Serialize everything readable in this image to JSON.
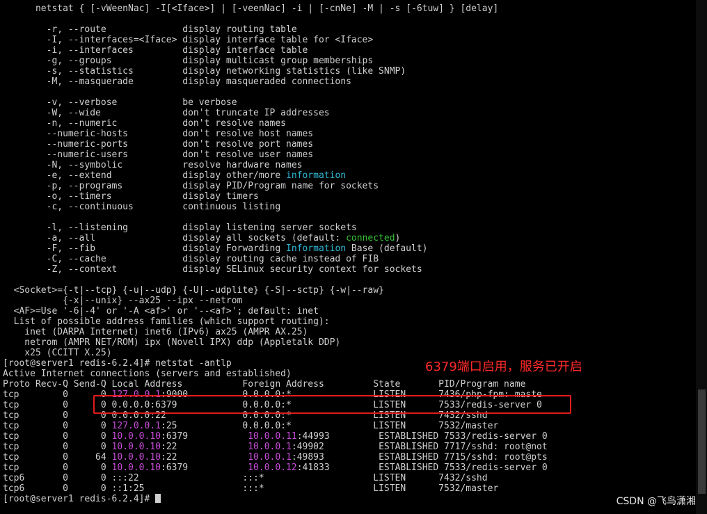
{
  "terminal": {
    "lines": [
      [
        [
          "      netstat { [-vWeenNac] -I[<Iface>] | [-veenNac] -i | [-cnNe] -M | -s [-6tuw] } [delay]",
          ""
        ]
      ],
      [
        [
          "",
          ""
        ]
      ],
      [
        [
          "        -r, --route              display routing table",
          ""
        ]
      ],
      [
        [
          "        -I, --interfaces=<Iface> display interface table for <Iface>",
          ""
        ]
      ],
      [
        [
          "        -i, --interfaces         display interface table",
          ""
        ]
      ],
      [
        [
          "        -g, --groups             display multicast group memberships",
          ""
        ]
      ],
      [
        [
          "        -s, --statistics         display networking statistics (like SNMP)",
          ""
        ]
      ],
      [
        [
          "        -M, --masquerade         display masqueraded connections",
          ""
        ]
      ],
      [
        [
          "",
          ""
        ]
      ],
      [
        [
          "        -v, --verbose            be verbose",
          ""
        ]
      ],
      [
        [
          "        -W, --wide               don't truncate IP addresses",
          ""
        ]
      ],
      [
        [
          "        -n, --numeric            don't resolve names",
          ""
        ]
      ],
      [
        [
          "        --numeric-hosts          don't resolve host names",
          ""
        ]
      ],
      [
        [
          "        --numeric-ports          don't resolve port names",
          ""
        ]
      ],
      [
        [
          "        --numeric-users          don't resolve user names",
          ""
        ]
      ],
      [
        [
          "        -N, --symbolic           resolve hardware names",
          ""
        ]
      ],
      [
        [
          "        -e, --extend             display other/more ",
          ""
        ],
        [
          "information",
          "cyan"
        ]
      ],
      [
        [
          "        -p, --programs           display PID/Program name for sockets",
          ""
        ]
      ],
      [
        [
          "        -o, --timers             display timers",
          ""
        ]
      ],
      [
        [
          "        -c, --continuous         continuous listing",
          ""
        ]
      ],
      [
        [
          "",
          ""
        ]
      ],
      [
        [
          "        -l, --listening          display listening server sockets",
          ""
        ]
      ],
      [
        [
          "        -a, --all                display all sockets (default: ",
          ""
        ],
        [
          "connected",
          "green"
        ],
        [
          ")",
          ""
        ]
      ],
      [
        [
          "        -F, --fib                display Forwarding ",
          ""
        ],
        [
          "Information",
          "cyan"
        ],
        [
          " Base (default)",
          ""
        ]
      ],
      [
        [
          "        -C, --cache              display routing cache instead of FIB",
          ""
        ]
      ],
      [
        [
          "        -Z, --context            display SELinux security context for sockets",
          ""
        ]
      ],
      [
        [
          "",
          ""
        ]
      ],
      [
        [
          "  <Socket>={-t|--tcp} {-u|--udp} {-U|--udplite} {-S|--sctp} {-w|--raw}",
          ""
        ]
      ],
      [
        [
          "           {-x|--unix} --ax25 --ipx --netrom",
          ""
        ]
      ],
      [
        [
          "  <AF>=Use '-6|-4' or '-A <af>' or '--<af>'; default: inet",
          ""
        ]
      ],
      [
        [
          "  List of possible address families (which support routing):",
          ""
        ]
      ],
      [
        [
          "    inet (DARPA Internet) inet6 (IPv6) ax25 (AMPR AX.25)",
          ""
        ]
      ],
      [
        [
          "    netrom (AMPR NET/ROM) ipx (Novell IPX) ddp (Appletalk DDP)",
          ""
        ]
      ],
      [
        [
          "    x25 (CCITT X.25)",
          ""
        ]
      ],
      [
        [
          "[root@server1 redis-6.2.4]# netstat -antlp",
          ""
        ]
      ],
      [
        [
          "Active Internet connections (servers and established)",
          ""
        ]
      ],
      [
        [
          "Proto Recv-Q Send-Q Local Address           Foreign Address         State       PID/Program name",
          ""
        ]
      ],
      [
        [
          "tcp        0      0 ",
          ""
        ],
        [
          "127.0.0.1",
          "magenta"
        ],
        [
          ":9000          0.0.0.0:*               LISTEN      7436/php-fpm: maste",
          ""
        ]
      ],
      [
        [
          "tcp        0      0 0.0.0.0:6379            0.0.0.0:*               LISTEN      7533/redis-server 0",
          ""
        ]
      ],
      [
        [
          "tcp        0      0 0.0.0.0:22              0.0.0.0:*               LISTEN      7432/sshd",
          ""
        ]
      ],
      [
        [
          "tcp        0      0 ",
          ""
        ],
        [
          "127.0.0.1",
          "magenta"
        ],
        [
          ":25            0.0.0.0:*               LISTEN      7532/master",
          ""
        ]
      ],
      [
        [
          "tcp        0      0 ",
          ""
        ],
        [
          "10.0.0.10",
          "magenta"
        ],
        [
          ":6379           ",
          ""
        ],
        [
          "10.0.0.11",
          "magenta"
        ],
        [
          ":44993         ESTABLISHED 7533/redis-server 0",
          ""
        ]
      ],
      [
        [
          "tcp        0      0 ",
          ""
        ],
        [
          "10.0.0.10",
          "magenta"
        ],
        [
          ":22             ",
          ""
        ],
        [
          "10.0.0.1",
          "magenta"
        ],
        [
          ":49902          ESTABLISHED 7717/sshd: root@not",
          ""
        ]
      ],
      [
        [
          "tcp        0     64 ",
          ""
        ],
        [
          "10.0.0.10",
          "magenta"
        ],
        [
          ":22             ",
          ""
        ],
        [
          "10.0.0.1",
          "magenta"
        ],
        [
          ":49893          ESTABLISHED 7715/sshd: root@pts",
          ""
        ]
      ],
      [
        [
          "tcp        0      0 ",
          ""
        ],
        [
          "10.0.0.10",
          "magenta"
        ],
        [
          ":6379           ",
          ""
        ],
        [
          "10.0.0.12",
          "magenta"
        ],
        [
          ":41833         ESTABLISHED 7533/redis-server 0",
          ""
        ]
      ],
      [
        [
          "tcp6       0      0 :::22                   :::*                    LISTEN      7432/sshd",
          ""
        ]
      ],
      [
        [
          "tcp6       0      0 ::1:25                  :::*                    LISTEN      7532/master",
          ""
        ]
      ],
      [
        [
          "[root@server1 redis-6.2.4]# ",
          ""
        ]
      ]
    ]
  },
  "annotation": {
    "text": "6379端口启用，服务已开启",
    "color": "#ff2a2a"
  },
  "watermark": {
    "text": "CSDN @飞鸟潇湘"
  },
  "colors": {
    "background": "#000000",
    "text": "#d0d0d0",
    "cyan": "#2fb9d6",
    "green": "#35c235",
    "magenta": "#c84cd9",
    "highlight": "#e21b1b"
  }
}
